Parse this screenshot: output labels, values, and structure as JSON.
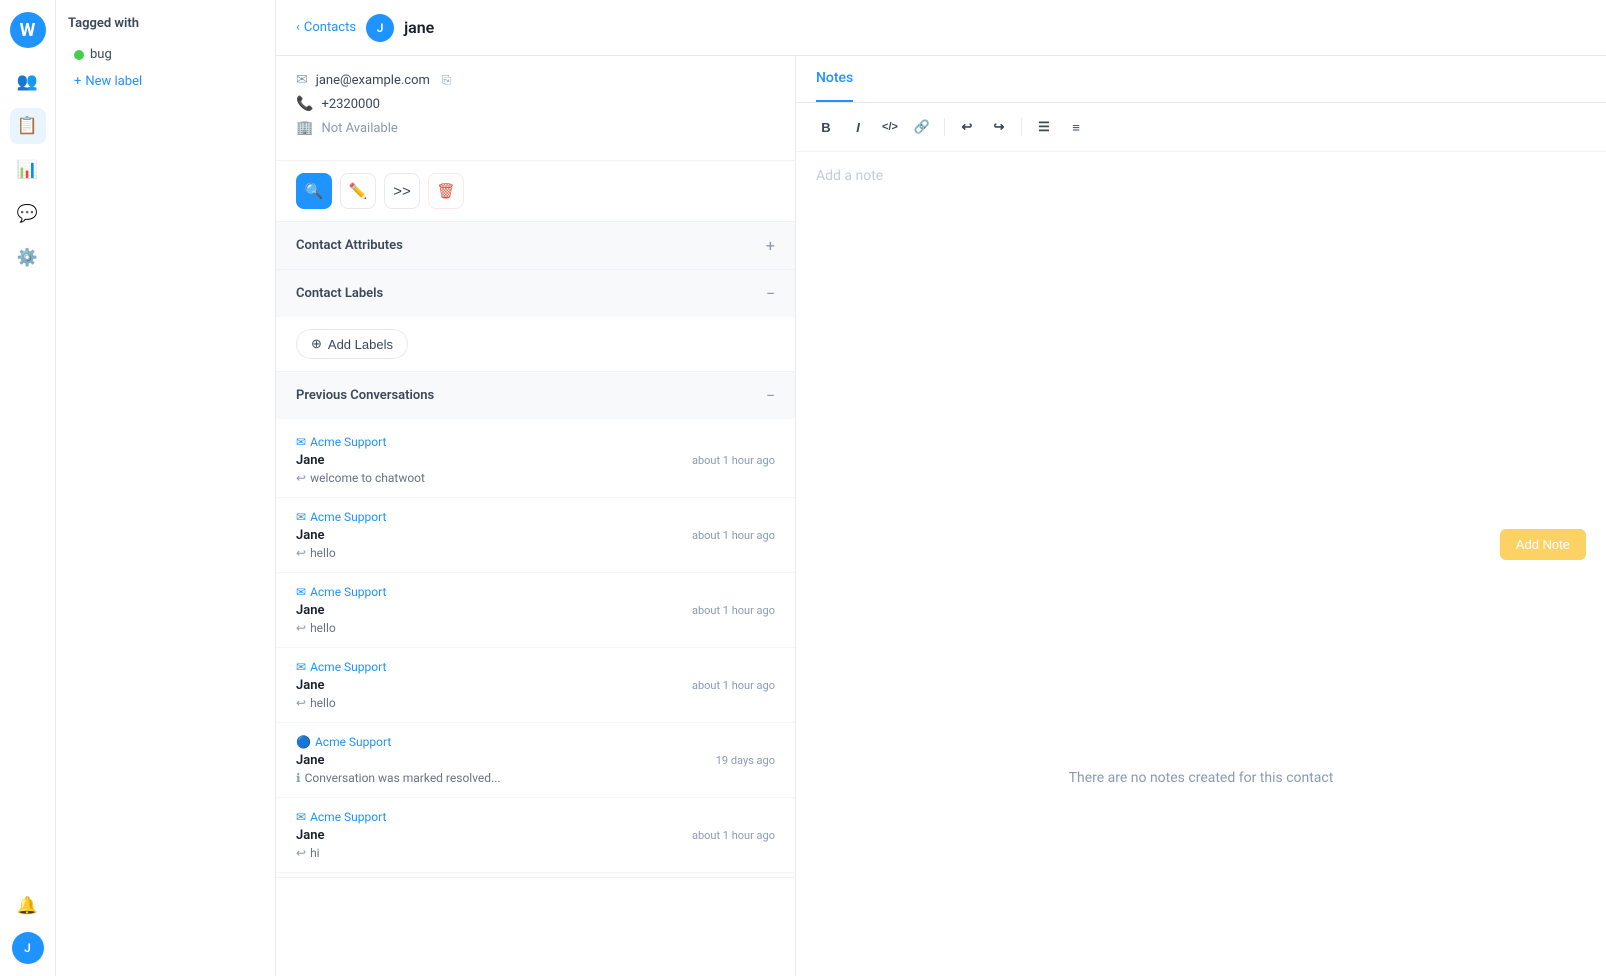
{
  "app": {
    "logo_text": "W"
  },
  "nav": {
    "items": [
      {
        "id": "contacts",
        "icon": "👥",
        "active": false
      },
      {
        "id": "dashboard",
        "icon": "📊",
        "active": false
      },
      {
        "id": "conversations",
        "icon": "💬",
        "active": false
      },
      {
        "id": "settings",
        "icon": "⚙️",
        "active": false
      }
    ],
    "avatar_text": "J"
  },
  "sidebar": {
    "title": "Tagged with",
    "labels": [
      {
        "id": "bug",
        "name": "bug",
        "color": "#44ce4b"
      }
    ],
    "new_label_text": "New label"
  },
  "header": {
    "back_text": "Contacts",
    "contact_avatar": "J",
    "contact_name": "jane"
  },
  "contact": {
    "email": "jane@example.com",
    "phone": "+2320000",
    "availability": "Not Available"
  },
  "actions": {
    "search_icon": "🔍",
    "edit_icon": "✏️",
    "forward_icon": ">>",
    "delete_icon": "🗑"
  },
  "sections": {
    "contact_attributes": {
      "title": "Contact Attributes",
      "toggle": "+"
    },
    "contact_labels": {
      "title": "Contact Labels",
      "toggle": "−",
      "add_button": "Add Labels"
    },
    "previous_conversations": {
      "title": "Previous Conversations",
      "toggle": "−"
    }
  },
  "conversations": [
    {
      "source": "Acme Support",
      "name": "Jane",
      "time": "about 1 hour ago",
      "preview": "welcome to chatwoot",
      "type": "reply"
    },
    {
      "source": "Acme Support",
      "name": "Jane",
      "time": "about 1 hour ago",
      "preview": "hello",
      "type": "reply"
    },
    {
      "source": "Acme Support",
      "name": "Jane",
      "time": "about 1 hour ago",
      "preview": "hello",
      "type": "reply"
    },
    {
      "source": "Acme Support",
      "name": "Jane",
      "time": "about 1 hour ago",
      "preview": "hello",
      "type": "reply"
    },
    {
      "source": "Acme Support",
      "name": "Jane",
      "time": "19 days ago",
      "preview": "Conversation was marked resolved...",
      "type": "info"
    },
    {
      "source": "Acme Support",
      "name": "Jane",
      "time": "about 1 hour ago",
      "preview": "hi",
      "type": "reply"
    }
  ],
  "notes": {
    "tab_label": "Notes",
    "placeholder": "Add a note",
    "empty_message": "There are no notes created for this contact",
    "submit_label": "Add Note",
    "toolbar": {
      "bold": "B",
      "italic": "I",
      "code": "<>",
      "link": "🔗",
      "undo": "↩",
      "redo": "↪",
      "list_unordered": "≡",
      "list_ordered": "≣"
    }
  }
}
